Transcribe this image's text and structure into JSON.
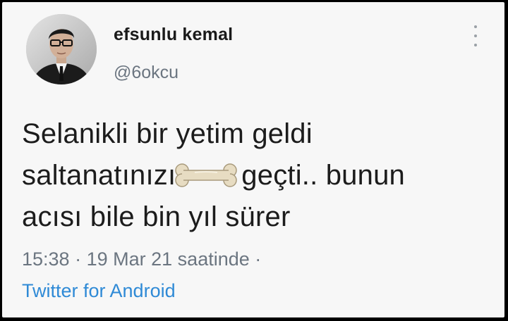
{
  "tweet": {
    "display_name": "efsunlu kemal",
    "handle": "@6okcu",
    "text_lines": [
      "Selanikli bir yetim geldi",
      "saltanatınızı",
      "geçti.. bunun",
      "acısı bile bin yıl sürer"
    ],
    "censored_word_icon": "bone-icon",
    "time": "15:38",
    "separator": "·",
    "date": "19 Mar 21 saatinde",
    "trailing_separator": "·",
    "source": "Twitter for Android"
  },
  "icons": {
    "more": "more-vertical-icon",
    "avatar": "avatar"
  },
  "colors": {
    "background": "#f7f7f7",
    "text": "#1c1c1c",
    "muted": "#6b7580",
    "link": "#2f8ad6"
  }
}
